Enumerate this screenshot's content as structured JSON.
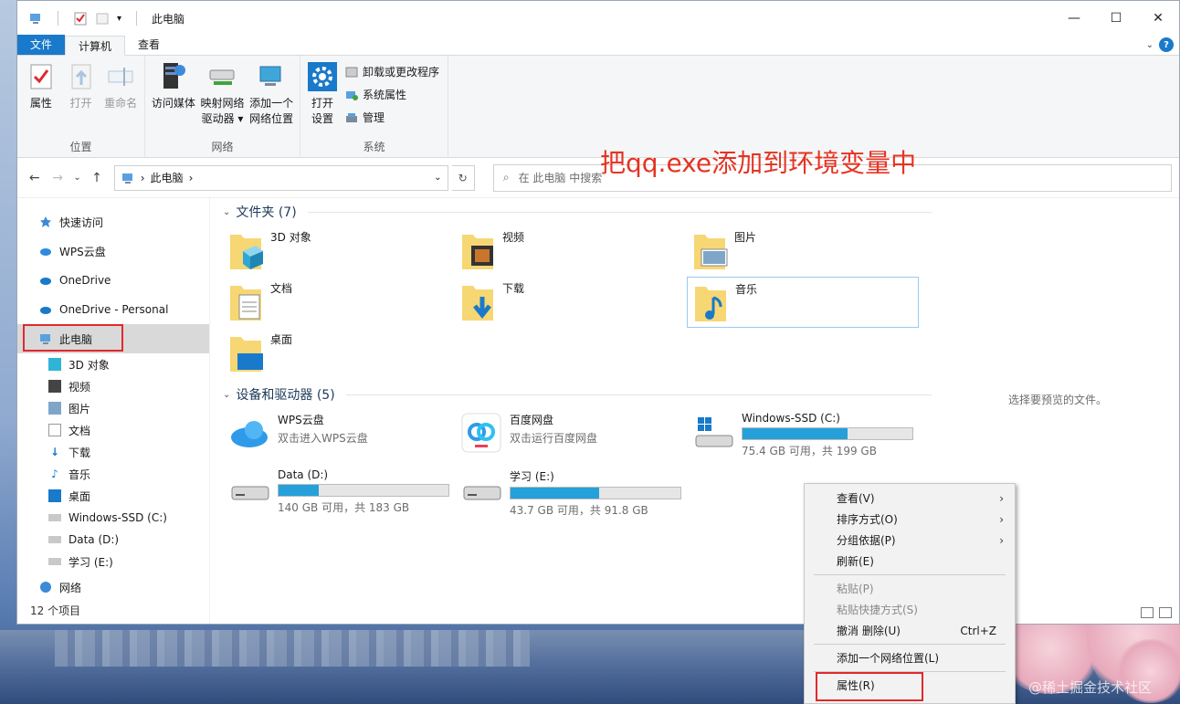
{
  "window": {
    "title": "此电脑",
    "controls": {
      "minimize": "—",
      "maximize": "☐",
      "close": "✕"
    }
  },
  "ribbon": {
    "tabs": [
      "文件",
      "计算机",
      "查看"
    ],
    "groups": {
      "location": {
        "label": "位置",
        "buttons": [
          "属性",
          "打开",
          "重命名"
        ]
      },
      "network": {
        "label": "网络",
        "buttons": [
          "访问媒体",
          "映射网络\n驱动器 ▾",
          "添加一个\n网络位置"
        ]
      },
      "system": {
        "label": "系统",
        "open_settings": "打开\n设置",
        "small": [
          "卸载或更改程序",
          "系统属性",
          "管理"
        ]
      }
    },
    "annotation": "把qq.exe添加到环境变量中"
  },
  "address": {
    "path": "此电脑",
    "search_placeholder": "在 此电脑 中搜索"
  },
  "nav": {
    "top_items": [
      "快速访问",
      "WPS云盘",
      "OneDrive",
      "OneDrive - Personal",
      "此电脑"
    ],
    "sub_items": [
      "3D 对象",
      "视频",
      "图片",
      "文档",
      "下载",
      "音乐",
      "桌面",
      "Windows-SSD (C:)",
      "Data (D:)",
      "学习 (E:)"
    ],
    "network": "网络",
    "status": "12 个项目"
  },
  "folders": {
    "header": "文件夹 (7)",
    "items": [
      "3D 对象",
      "视频",
      "图片",
      "文档",
      "下载",
      "音乐",
      "桌面"
    ]
  },
  "devices": {
    "header": "设备和驱动器 (5)",
    "wps": {
      "name": "WPS云盘",
      "desc": "双击进入WPS云盘"
    },
    "baidu": {
      "name": "百度网盘",
      "desc": "双击运行百度网盘"
    },
    "drives": [
      {
        "name": "Windows-SSD (C:)",
        "free": "75.4 GB 可用，共 199 GB",
        "used_fraction": 0.62
      },
      {
        "name": "Data (D:)",
        "free": "140 GB 可用，共 183 GB",
        "used_fraction": 0.235
      },
      {
        "name": "学习 (E:)",
        "free": "43.7 GB 可用，共 91.8 GB",
        "used_fraction": 0.524
      }
    ]
  },
  "preview": {
    "empty_text": "选择要预览的文件。"
  },
  "context_menu": {
    "items": [
      "查看(V)",
      "排序方式(O)",
      "分组依据(P)",
      "刷新(E)",
      "粘贴(P)",
      "粘贴快捷方式(S)",
      "撤消 删除(U)",
      "添加一个网络位置(L)",
      "属性(R)"
    ],
    "undo_shortcut": "Ctrl+Z",
    "submenu_arrow": "›"
  },
  "watermark": "@稀土掘金技术社区",
  "colors": {
    "accent": "#1979ca",
    "annotation": "#e53323",
    "highlight_box": "#e0292c",
    "drive_bar": "#26a0da"
  }
}
